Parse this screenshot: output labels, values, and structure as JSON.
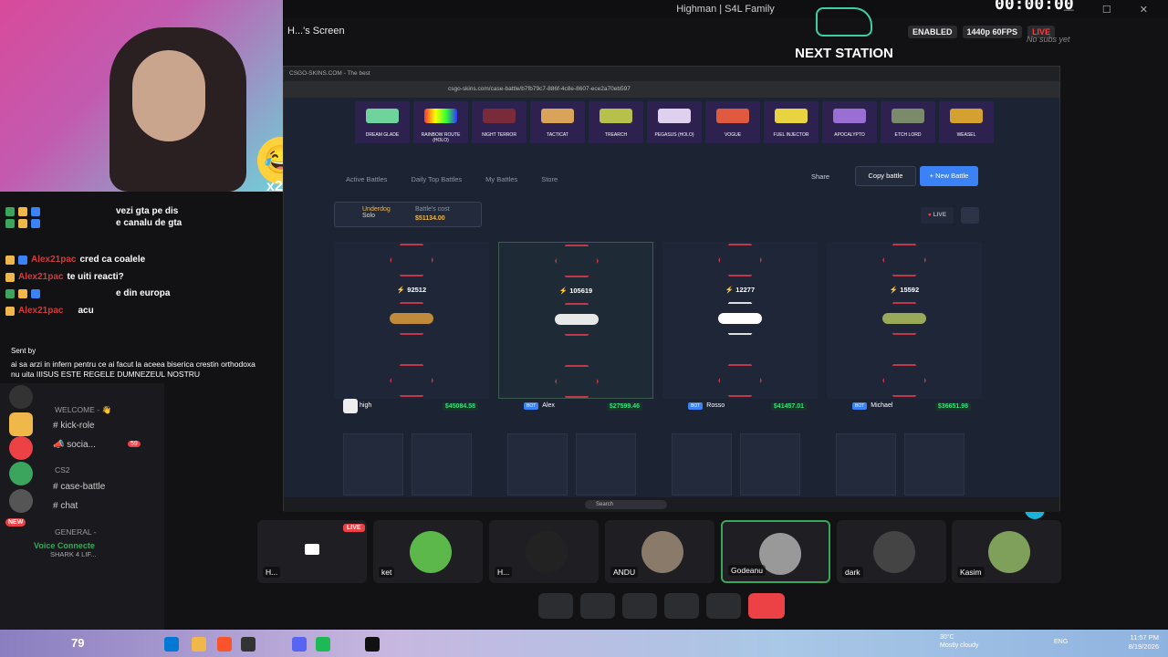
{
  "topbar": {
    "title": "Highman | S4L Family",
    "timer": "00:00:00"
  },
  "screen_title": "H...'s Screen",
  "overlay": {
    "next_station": "NEXT STATION",
    "enabled": "ENABLED",
    "quality": "1440p 60FPS",
    "live": "LIVE",
    "no_subs": "No subs yet",
    "emoji_mult": "x2",
    "bottom_num": "79"
  },
  "chat": {
    "lines": [
      {
        "user": "",
        "msg": "vezi gta pe dis"
      },
      {
        "user": "",
        "msg": "e canalu de gta"
      },
      {
        "user": "Alex21pac",
        "msg": "cred ca coalele"
      },
      {
        "user": "Alex21pac",
        "msg": "te uiti reacti?"
      },
      {
        "user": "",
        "msg": "e din europa"
      },
      {
        "user": "Alex21pac",
        "msg": "acu"
      }
    ],
    "sent_by": "Sent by",
    "long_msg": "ai sa arzi in infern pentru ce ai facut la aceea biserica crestin orthodoxa nu uita IIISUS ESTE REGELE DUMNEZEUL NOSTRU"
  },
  "sidebar": {
    "cat_welcome": "WELCOME - 👋",
    "chan_kick": "kick-role",
    "chan_social": "socia...",
    "social_badge": "59",
    "cat_cs2": "CS2",
    "chan_case": "case-battle",
    "chan_chat": "chat",
    "cat_general": "GENERAL -",
    "new_badge": "NEW",
    "voice_title": "Voice Connecte",
    "voice_sub": "SHARK 4 LIF..."
  },
  "browser": {
    "tab": "CSGO-SKINS.COM - The best",
    "url": "csgo-skins.com/case-battle/b7fb79c7-886f-4c8e-8607-ece2a70eb597",
    "drops": [
      "DREAM GLADE",
      "RAINBOW ROUTE (HOLO)",
      "NIGHT TERROR",
      "TACTICAT",
      "TREARCH",
      "PEGASUS (HOLO)",
      "VOGUE",
      "FUEL INJECTOR",
      "APOCALYPTO",
      "ETCH LORD",
      "WEASEL"
    ],
    "nav": [
      "Active Battles",
      "Daily Top Battles",
      "My Battles",
      "Store"
    ],
    "share": "Share",
    "copy_battle": "Copy battle",
    "new_battle": "+ New Battle",
    "mode": "Underdog",
    "mode_sub": "Solo",
    "cost_label": "Battle's cost",
    "cost_value": "$51134.00",
    "live_btn": "LIVE",
    "columns": [
      {
        "value": "92512",
        "player": "high",
        "amount": "$45084.58",
        "bot": ""
      },
      {
        "value": "105619",
        "player": "Alex",
        "amount": "$27599.46",
        "bot": "BOT"
      },
      {
        "value": "12277",
        "player": "Rosso",
        "amount": "$41457.01",
        "bot": "BOT"
      },
      {
        "value": "15592",
        "player": "Michael",
        "amount": "$36651.98",
        "bot": "BOT"
      }
    ],
    "taskbar_search": "Search"
  },
  "tiles": [
    {
      "name": "H...",
      "live": "LIVE"
    },
    {
      "name": "ket"
    },
    {
      "name": "H..."
    },
    {
      "name": "ANDU"
    },
    {
      "name": "Godeanu"
    },
    {
      "name": "dark"
    },
    {
      "name": "Kasim"
    }
  ],
  "win": {
    "time": "11:57 PM",
    "date": "8/19/2026",
    "weather": "30°C",
    "weather_sub": "Mostly cloudy",
    "lang": "ENG"
  },
  "colors": {
    "accent": "#3b82f6",
    "live": "#ed4245",
    "gold": "#f0b84a",
    "green": "#3ddc84"
  }
}
